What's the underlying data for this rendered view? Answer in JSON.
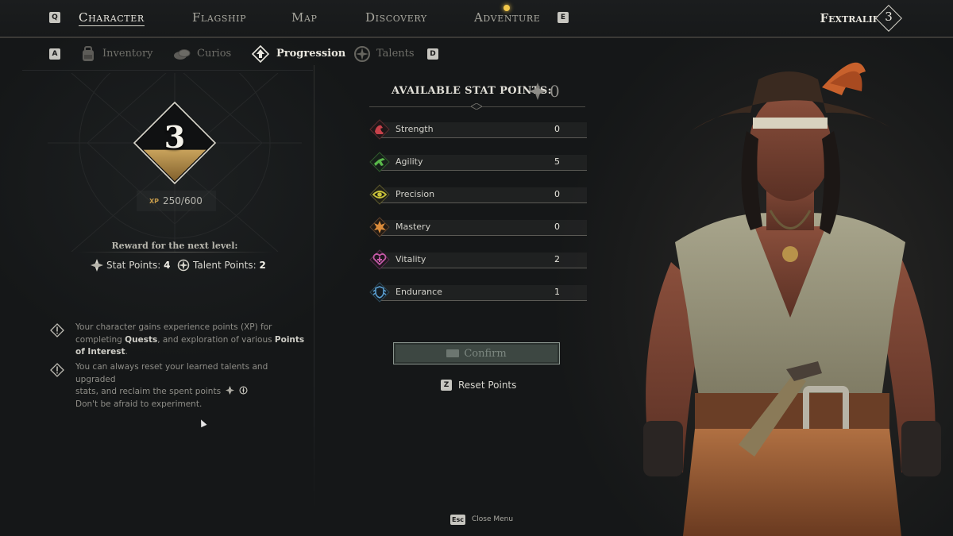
{
  "nav": {
    "left_key": "Q",
    "right_key": "E",
    "tabs": [
      {
        "label": "Character"
      },
      {
        "label": "Flagship"
      },
      {
        "label": "Map"
      },
      {
        "label": "Discovery"
      },
      {
        "label": "Adventure"
      }
    ],
    "player_name": "Fextralife",
    "player_level": "3"
  },
  "subnav": {
    "left_key": "A",
    "right_key": "D",
    "tabs": [
      {
        "label": "Inventory",
        "icon": "backpack-icon"
      },
      {
        "label": "Curios",
        "icon": "coins-icon"
      },
      {
        "label": "Progression",
        "icon": "level-up-icon"
      },
      {
        "label": "Talents",
        "icon": "talent-compass-icon"
      }
    ]
  },
  "progression": {
    "level": "3",
    "xp_label": "XP",
    "xp": "250/600",
    "xp_fraction": 0.4167,
    "reward_title": "Reward for the next level:",
    "stat_points_label": "Stat Points: ",
    "stat_points_value": "4",
    "talent_points_label": "Talent Points: ",
    "talent_points_value": "2"
  },
  "tips": [
    {
      "pre": "Your character gains experience points (XP) for completing ",
      "bold1": "Quests",
      "mid": ", and exploration of various ",
      "bold2": "Points of Interest",
      "post": "."
    },
    {
      "line1": "You can always reset your learned talents and upgraded",
      "line2": "stats, and reclaim the spent points",
      "line3": "Don't be afraid to experiment."
    }
  ],
  "stats": {
    "available_label": "AVAILABLE STAT POINTS:",
    "available_value": "0",
    "items": [
      {
        "name": "Strength",
        "value": "0",
        "icon": "flexed-arm-icon",
        "color": "#c8414a"
      },
      {
        "name": "Agility",
        "value": "5",
        "icon": "leaping-figure-icon",
        "color": "#59b84a"
      },
      {
        "name": "Precision",
        "value": "0",
        "icon": "eye-icon",
        "color": "#c9c23a"
      },
      {
        "name": "Mastery",
        "value": "0",
        "icon": "burst-icon",
        "color": "#d98a3a"
      },
      {
        "name": "Vitality",
        "value": "2",
        "icon": "heart-icon",
        "color": "#c65aa8"
      },
      {
        "name": "Endurance",
        "value": "1",
        "icon": "shield-figure-icon",
        "color": "#5a9ed0"
      }
    ]
  },
  "actions": {
    "confirm": "Confirm",
    "reset_key": "Z",
    "reset": "Reset Points",
    "close_key": "Esc",
    "close": "Close Menu"
  },
  "colors": {
    "background": "#141617",
    "accent_gold": "#b8934a",
    "text_light": "#e8e6de",
    "confirm_bg": "#3d4742"
  }
}
